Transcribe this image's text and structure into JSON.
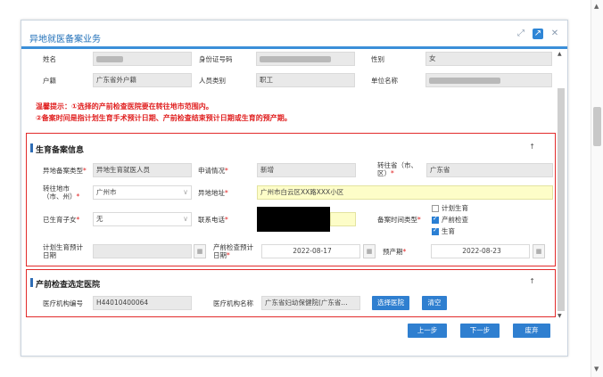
{
  "dialog": {
    "title": "异地就医备案业务",
    "icons": {
      "expand": "expand-icon",
      "popout": "popout-icon",
      "close": "close-icon"
    }
  },
  "person": {
    "name_label": "姓名",
    "id_label": "身份证号码",
    "gender_label": "性别",
    "gender_value": "女",
    "huji_label": "户籍",
    "huji_value": "广东省外户籍",
    "category_label": "人员类别",
    "category_value": "职工",
    "unit_label": "单位名称"
  },
  "warning": {
    "line1": "温馨提示：①选择的产前检查医院要在转往地市范围内。",
    "line2": "②备案时间是指计划生育手术预计日期、产前检查结束预计日期或生育的预产期。"
  },
  "birth_section": {
    "title": "生育备案信息",
    "remote_type_label": "异地备案类型",
    "remote_type_value": "异地生育就医人员",
    "apply_status_label": "申请情况",
    "apply_status_value": "新增",
    "to_province_label": "转往省（市、区）",
    "to_province_value": "广东省",
    "to_city_label": "转往地市（市、州）",
    "to_city_value": "广州市",
    "remote_address_label": "异地地址",
    "remote_address_value": "广州市白云区XX路XXX小区",
    "children_label": "已生育子女",
    "children_value": "无",
    "phone_label": "联系电话",
    "record_time_type_label": "备案时间类型",
    "opt_planning": "计划生育",
    "opt_prenatal": "产前检查",
    "opt_birth": "生育",
    "planning_date_label": "计划生育预计日期",
    "prenatal_date_label": "产前检查预计日期",
    "prenatal_date_value": "2022-08-17",
    "due_date_label": "预产期",
    "due_date_value": "2022-08-23"
  },
  "hospital_section": {
    "title": "产前检查选定医院",
    "code_label": "医疗机构编号",
    "code_value": "H44010400064",
    "name_label": "医疗机构名称",
    "name_value": "广东省妇幼保健院(广东省...",
    "select_btn": "选择医院",
    "clear_btn": "清空"
  },
  "footer": {
    "prev": "上一步",
    "next": "下一步",
    "discard": "废弃"
  },
  "colors": {
    "accent": "#2f7fd0",
    "warn": "#e02020"
  }
}
